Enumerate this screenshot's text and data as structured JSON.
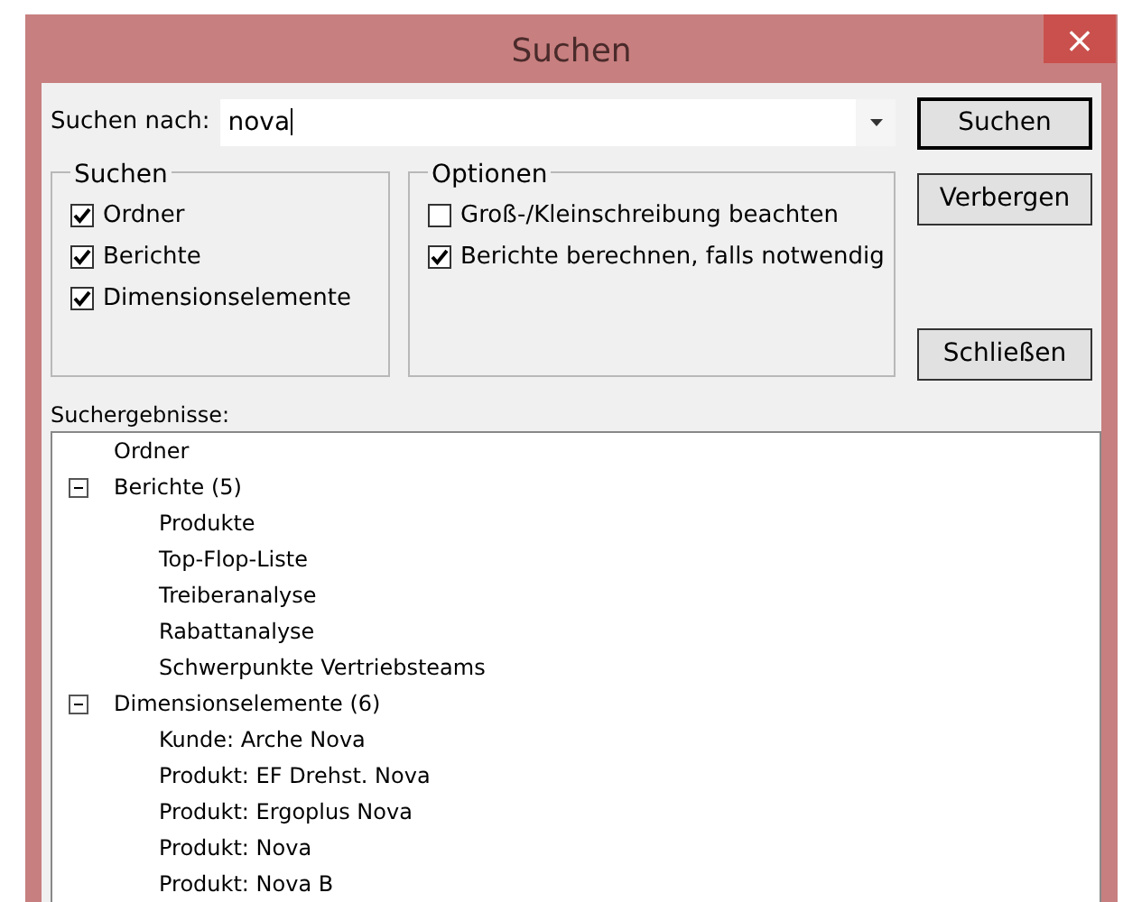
{
  "window": {
    "title": "Suchen",
    "close": "×"
  },
  "search": {
    "label": "Suchen nach:",
    "value": "nova"
  },
  "buttons": [
    {
      "label": "Suchen",
      "default": true
    },
    {
      "label": "Verbergen",
      "default": false
    },
    {
      "label": "Schließen",
      "default": false
    }
  ],
  "groups": [
    {
      "title": "Suchen",
      "options": [
        {
          "label": "Ordner",
          "checked": true
        },
        {
          "label": "Berichte",
          "checked": true
        },
        {
          "label": "Dimensionselemente",
          "checked": true
        }
      ]
    },
    {
      "title": "Optionen",
      "options": [
        {
          "label": "Groß-/Kleinschreibung beachten",
          "checked": false
        },
        {
          "label": "Berichte berechnen, falls notwendig",
          "checked": true
        }
      ]
    }
  ],
  "results": {
    "label": "Suchergebnisse:",
    "items": [
      {
        "label": "Ordner"
      },
      {
        "label": "Berichte (5)",
        "expanded": true,
        "children": [
          {
            "label": "Produkte"
          },
          {
            "label": "Top-Flop-Liste"
          },
          {
            "label": "Treiberanalyse"
          },
          {
            "label": "Rabattanalyse"
          },
          {
            "label": "Schwerpunkte Vertriebsteams"
          }
        ]
      },
      {
        "label": "Dimensionselemente (6)",
        "expanded": true,
        "children": [
          {
            "label": "Kunde: Arche Nova"
          },
          {
            "label": "Produkt: EF Drehst. Nova"
          },
          {
            "label": "Produkt: Ergoplus Nova"
          },
          {
            "label": "Produkt: Nova"
          },
          {
            "label": "Produkt: Nova B"
          }
        ]
      }
    ]
  }
}
